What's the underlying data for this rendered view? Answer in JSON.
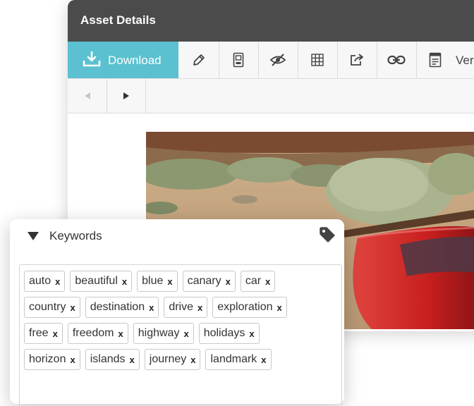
{
  "window": {
    "title": "Asset Details"
  },
  "toolbar": {
    "download_label": "Download",
    "tools": [
      {
        "icon": "pencil-icon"
      },
      {
        "icon": "document-frame-icon"
      },
      {
        "icon": "eye-hidden-icon"
      },
      {
        "icon": "grid-icon"
      },
      {
        "icon": "share-icon"
      },
      {
        "icon": "link-icon"
      },
      {
        "icon": "versions-icon",
        "label": "Vers"
      }
    ]
  },
  "nav": {
    "prev_icon": "triangle-left-icon",
    "next_icon": "triangle-right-icon"
  },
  "colors": {
    "titlebar": "#4b4b4b",
    "accent": "#5bc0cf",
    "car": "#c81f1f"
  },
  "keywords": {
    "title": "Keywords",
    "remove_label": "x",
    "rows": [
      [
        "auto",
        "beautiful",
        "blue",
        "canary",
        "car"
      ],
      [
        "country",
        "destination",
        "drive",
        "exploration"
      ],
      [
        "free",
        "freedom",
        "highway",
        "holidays"
      ],
      [
        "horizon",
        "islands",
        "journey",
        "landmark"
      ]
    ]
  }
}
